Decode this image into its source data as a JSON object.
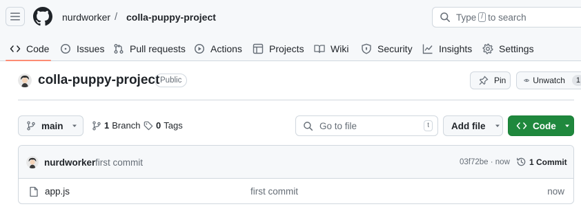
{
  "colors": {
    "accent_green": "#1f883d",
    "tab_underline": "#fd8c73",
    "border": "#d0d7de",
    "muted_text": "#656d76"
  },
  "header": {
    "menu_icon": "hamburger-icon",
    "logo_icon": "github-mark-icon",
    "owner": "nurdworker",
    "separator": "/",
    "repo": "colla-puppy-project",
    "search": {
      "prefix": "Type",
      "key": "/",
      "suffix": "to search",
      "icon": "search-icon"
    }
  },
  "tabs": [
    {
      "label": "Code",
      "icon": "code-icon",
      "selected": true
    },
    {
      "label": "Issues",
      "icon": "issue-opened-icon"
    },
    {
      "label": "Pull requests",
      "icon": "git-pull-request-icon"
    },
    {
      "label": "Actions",
      "icon": "play-icon"
    },
    {
      "label": "Projects",
      "icon": "table-icon"
    },
    {
      "label": "Wiki",
      "icon": "book-icon"
    },
    {
      "label": "Security",
      "icon": "shield-icon"
    },
    {
      "label": "Insights",
      "icon": "graph-icon"
    },
    {
      "label": "Settings",
      "icon": "gear-icon"
    }
  ],
  "repo_header": {
    "title": "colla-puppy-project",
    "visibility": "Public",
    "pin_label": "Pin",
    "watch_label": "Unwatch",
    "watch_count": "1"
  },
  "toolbar": {
    "branch": "main",
    "branch_count": "1",
    "branch_label": "Branch",
    "tag_count": "0",
    "tag_label": "Tags",
    "goto_placeholder": "Go to file",
    "goto_key": "t",
    "add_file_label": "Add file",
    "code_label": "Code"
  },
  "latest_commit": {
    "author": "nurdworker",
    "message": "first commit",
    "meta": "03f72be · now",
    "commit_count_label": "1 Commit"
  },
  "files": [
    {
      "name": "app.js",
      "commit_message": "first commit",
      "time": "now",
      "icon": "file-icon"
    }
  ]
}
